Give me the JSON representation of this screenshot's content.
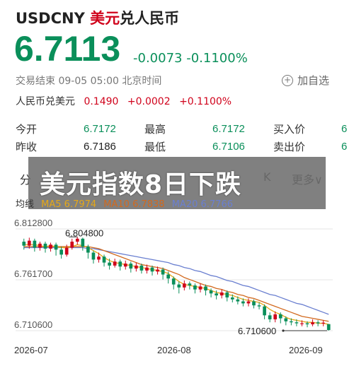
{
  "header": {
    "symbol": "USDCNY",
    "name_red": "美元",
    "name_black": "兑人民币",
    "price": "6.7113",
    "change": "-0.0073",
    "change_pct": "-0.1100%",
    "status": "交易结束 09-05 05:00 北京时间",
    "watch_label": "加自选",
    "inverse_label": "人民币兑美元",
    "inverse_price": "0.1490",
    "inverse_change": "+0.0002",
    "inverse_pct": "+0.1100%"
  },
  "stats": {
    "open_label": "今开",
    "open": "6.7172",
    "prev_label": "昨收",
    "prev": "6.7186",
    "high_label": "最高",
    "high": "6.7172",
    "low_label": "最低",
    "low": "6.7106",
    "bid_label": "买入价",
    "bid": "6",
    "ask_label": "卖出价",
    "ask": "6"
  },
  "banner": {
    "text": "美元指数8日下跌"
  },
  "tabs": {
    "left": "分",
    "mid": "K",
    "more": "更多"
  },
  "legend": {
    "ma_label": "均线",
    "ma5": "MA5 6.7974",
    "ma10": "MA10 6.7838",
    "ma20": "MA20 6.7766"
  },
  "colors": {
    "up": "#d0021b",
    "down": "#0a8f5a",
    "ma5": "#e6a817",
    "ma10": "#d2691e",
    "ma20": "#6a7fd0"
  },
  "chart_data": {
    "type": "candlestick",
    "y_ticks": [
      "6.812800",
      "6.761700",
      "6.710600"
    ],
    "x_ticks": [
      "2026-07",
      "2026-08",
      "2026-09"
    ],
    "annotations": {
      "high": "6.804800",
      "low": "6.710600"
    },
    "ylim": [
      6.7106,
      6.8128
    ],
    "candles": [
      [
        6.8,
        6.796,
        6.803,
        6.792
      ],
      [
        6.796,
        6.801,
        6.804,
        6.793
      ],
      [
        6.801,
        6.794,
        6.803,
        6.79
      ],
      [
        6.794,
        6.798,
        6.8,
        6.791
      ],
      [
        6.798,
        6.793,
        6.8,
        6.789
      ],
      [
        6.793,
        6.797,
        6.799,
        6.79
      ],
      [
        6.797,
        6.792,
        6.799,
        6.786
      ],
      [
        6.792,
        6.787,
        6.795,
        6.783
      ],
      [
        6.787,
        6.794,
        6.797,
        6.785
      ],
      [
        6.794,
        6.8,
        6.803,
        6.792
      ],
      [
        6.8,
        6.803,
        6.8048,
        6.797
      ],
      [
        6.803,
        6.795,
        6.804,
        6.791
      ],
      [
        6.795,
        6.789,
        6.797,
        6.783
      ],
      [
        6.789,
        6.782,
        6.791,
        6.778
      ],
      [
        6.782,
        6.785,
        6.789,
        6.779
      ],
      [
        6.785,
        6.779,
        6.787,
        6.775
      ],
      [
        6.779,
        6.776,
        6.783,
        6.772
      ],
      [
        6.776,
        6.78,
        6.783,
        6.774
      ],
      [
        6.78,
        6.775,
        6.782,
        6.771
      ],
      [
        6.775,
        6.778,
        6.781,
        6.772
      ],
      [
        6.778,
        6.773,
        6.78,
        6.769
      ],
      [
        6.773,
        6.776,
        6.779,
        6.77
      ],
      [
        6.776,
        6.771,
        6.778,
        6.768
      ],
      [
        6.771,
        6.774,
        6.777,
        6.768
      ],
      [
        6.774,
        6.77,
        6.776,
        6.766
      ],
      [
        6.77,
        6.772,
        6.775,
        6.767
      ],
      [
        6.772,
        6.767,
        6.774,
        6.762
      ],
      [
        6.767,
        6.763,
        6.77,
        6.758
      ],
      [
        6.763,
        6.757,
        6.765,
        6.752
      ],
      [
        6.757,
        6.754,
        6.76,
        6.748
      ],
      [
        6.754,
        6.758,
        6.761,
        6.751
      ],
      [
        6.758,
        6.756,
        6.76,
        6.752
      ],
      [
        6.756,
        6.752,
        6.758,
        6.748
      ],
      [
        6.752,
        6.755,
        6.758,
        6.749
      ],
      [
        6.755,
        6.751,
        6.757,
        6.746
      ],
      [
        6.751,
        6.748,
        6.753,
        6.744
      ],
      [
        6.748,
        6.746,
        6.751,
        6.742
      ],
      [
        6.746,
        6.749,
        6.752,
        6.743
      ],
      [
        6.749,
        6.744,
        6.751,
        6.74
      ],
      [
        6.744,
        6.742,
        6.747,
        6.739
      ],
      [
        6.742,
        6.74,
        6.745,
        6.737
      ],
      [
        6.74,
        6.738,
        6.743,
        6.735
      ],
      [
        6.738,
        6.74,
        6.743,
        6.735
      ],
      [
        6.74,
        6.736,
        6.742,
        6.733
      ],
      [
        6.736,
        6.735,
        6.739,
        6.732
      ],
      [
        6.735,
        6.726,
        6.737,
        6.722
      ],
      [
        6.726,
        6.722,
        6.729,
        6.719
      ],
      [
        6.722,
        6.727,
        6.73,
        6.719
      ],
      [
        6.727,
        6.723,
        6.729,
        6.718
      ],
      [
        6.723,
        6.72,
        6.725,
        6.716
      ],
      [
        6.72,
        6.719,
        6.723,
        6.716
      ],
      [
        6.719,
        6.718,
        6.722,
        6.715
      ],
      [
        6.718,
        6.718,
        6.721,
        6.715
      ],
      [
        6.718,
        6.717,
        6.72,
        6.714
      ],
      [
        6.717,
        6.719,
        6.722,
        6.715
      ],
      [
        6.719,
        6.718,
        6.721,
        6.715
      ],
      [
        6.718,
        6.7186,
        6.721,
        6.715
      ],
      [
        6.7172,
        6.7113,
        6.7172,
        6.7106
      ]
    ],
    "ma5": [
      6.797,
      6.797,
      6.797,
      6.796,
      6.795,
      6.796,
      6.795,
      6.794,
      6.794,
      6.795,
      6.797,
      6.796,
      6.794,
      6.791,
      6.788,
      6.784,
      6.781,
      6.779,
      6.778,
      6.777,
      6.776,
      6.775,
      6.774,
      6.773,
      6.772,
      6.771,
      6.77,
      6.768,
      6.764,
      6.76,
      6.757,
      6.756,
      6.755,
      6.754,
      6.753,
      6.751,
      6.749,
      6.748,
      6.747,
      6.746,
      6.744,
      6.742,
      6.741,
      6.74,
      6.739,
      6.736,
      6.732,
      6.729,
      6.727,
      6.724,
      6.722,
      6.721,
      6.72,
      6.719,
      6.719,
      6.718,
      6.718,
      6.717
    ],
    "ma10": [
      6.795,
      6.795,
      6.795,
      6.795,
      6.795,
      6.795,
      6.795,
      6.795,
      6.795,
      6.795,
      6.795,
      6.795,
      6.795,
      6.794,
      6.793,
      6.791,
      6.789,
      6.787,
      6.785,
      6.783,
      6.781,
      6.779,
      6.777,
      6.776,
      6.775,
      6.774,
      6.773,
      6.771,
      6.769,
      6.767,
      6.764,
      6.762,
      6.76,
      6.758,
      6.756,
      6.755,
      6.753,
      6.752,
      6.75,
      6.749,
      6.747,
      6.746,
      6.744,
      6.743,
      6.741,
      6.739,
      6.737,
      6.735,
      6.733,
      6.731,
      6.729,
      6.727,
      6.725,
      6.724,
      6.723,
      6.722,
      6.721,
      6.72
    ],
    "ma20": [
      6.794,
      6.794,
      6.794,
      6.794,
      6.794,
      6.794,
      6.794,
      6.794,
      6.794,
      6.794,
      6.794,
      6.794,
      6.793,
      6.793,
      6.792,
      6.791,
      6.79,
      6.789,
      6.788,
      6.787,
      6.786,
      6.785,
      6.784,
      6.783,
      6.782,
      6.781,
      6.78,
      6.779,
      6.777,
      6.776,
      6.774,
      6.773,
      6.771,
      6.77,
      6.768,
      6.766,
      6.765,
      6.763,
      6.761,
      6.76,
      6.758,
      6.756,
      6.755,
      6.753,
      6.751,
      6.749,
      6.747,
      6.746,
      6.744,
      6.742,
      6.74,
      6.738,
      6.737,
      6.735,
      6.733,
      6.731,
      6.729,
      6.727
    ]
  }
}
